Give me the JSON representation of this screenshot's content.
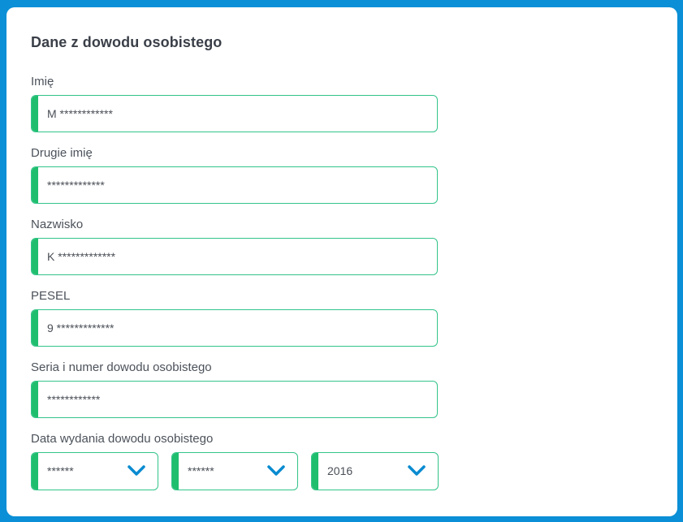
{
  "form": {
    "title": "Dane z dowodu osobistego",
    "fields": [
      {
        "label": "Imię",
        "value": "M ************"
      },
      {
        "label": "Drugie imię",
        "value": " *************"
      },
      {
        "label": "Nazwisko",
        "value": "K *************"
      },
      {
        "label": "PESEL",
        "value": "9 *************"
      },
      {
        "label": "Seria i numer dowodu osobistego",
        "value": " ************"
      }
    ],
    "date": {
      "label": "Data wydania dowodu osobistego",
      "day": "******",
      "month": "******",
      "year": "2016"
    }
  },
  "colors": {
    "background": "#0b8fd6",
    "accent_green": "#1fbe6e",
    "chevron_blue": "#0a8bd0"
  },
  "icons": {
    "select_arrow": "chevron-down-icon"
  }
}
